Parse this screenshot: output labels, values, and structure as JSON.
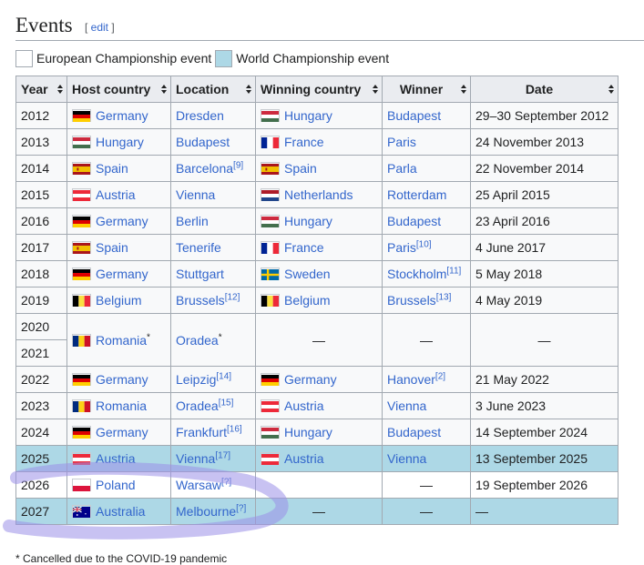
{
  "section": {
    "title": "Events",
    "edit_label": "edit",
    "edit_open": "[ ",
    "edit_close": " ]"
  },
  "legend": [
    {
      "label": "European Championship event",
      "color": "#ffffff"
    },
    {
      "label": "World Championship event",
      "color": "#add8e6"
    }
  ],
  "table": {
    "headers": [
      "Year",
      "Host country",
      "Location",
      "Winning country",
      "Winner",
      "Date"
    ],
    "rows": [
      {
        "year": "2012",
        "host": "Germany",
        "host_flag": "de",
        "location": "Dresden",
        "loc_ref": "",
        "win_country": "Hungary",
        "win_flag": "hu",
        "winner": "Budapest",
        "win_ref": "",
        "date": "29–30 September 2012",
        "type": "european"
      },
      {
        "year": "2013",
        "host": "Hungary",
        "host_flag": "hu",
        "location": "Budapest",
        "loc_ref": "",
        "win_country": "France",
        "win_flag": "fr",
        "winner": "Paris",
        "win_ref": "",
        "date": "24 November 2013",
        "type": "european"
      },
      {
        "year": "2014",
        "host": "Spain",
        "host_flag": "es",
        "location": "Barcelona",
        "loc_ref": "[9]",
        "win_country": "Spain",
        "win_flag": "es",
        "winner": "Parla",
        "win_ref": "",
        "date": "22 November 2014",
        "type": "european"
      },
      {
        "year": "2015",
        "host": "Austria",
        "host_flag": "at",
        "location": "Vienna",
        "loc_ref": "",
        "win_country": "Netherlands",
        "win_flag": "nl",
        "winner": "Rotterdam",
        "win_ref": "",
        "date": "25 April 2015",
        "type": "european"
      },
      {
        "year": "2016",
        "host": "Germany",
        "host_flag": "de",
        "location": "Berlin",
        "loc_ref": "",
        "win_country": "Hungary",
        "win_flag": "hu",
        "winner": "Budapest",
        "win_ref": "",
        "date": "23 April 2016",
        "type": "european"
      },
      {
        "year": "2017",
        "host": "Spain",
        "host_flag": "es",
        "location": "Tenerife",
        "loc_ref": "",
        "win_country": "France",
        "win_flag": "fr",
        "winner": "Paris",
        "win_ref": "[10]",
        "date": "4 June 2017",
        "type": "european"
      },
      {
        "year": "2018",
        "host": "Germany",
        "host_flag": "de",
        "location": "Stuttgart",
        "loc_ref": "",
        "win_country": "Sweden",
        "win_flag": "se",
        "winner": "Stockholm",
        "win_ref": "[11]",
        "date": "5 May 2018",
        "type": "european"
      },
      {
        "year": "2019",
        "host": "Belgium",
        "host_flag": "be",
        "location": "Brussels",
        "loc_ref": "[12]",
        "win_country": "Belgium",
        "win_flag": "be",
        "winner": "Brussels",
        "win_ref": "[13]",
        "date": "4 May 2019",
        "type": "european"
      }
    ],
    "merged": {
      "years": [
        "2020",
        "2021"
      ],
      "host": "Romania",
      "host_flag": "ro",
      "host_note": "*",
      "location": "Oradea",
      "loc_note": "*",
      "win_country": "—",
      "winner": "—",
      "date": "—"
    },
    "rows2": [
      {
        "year": "2022",
        "host": "Germany",
        "host_flag": "de",
        "location": "Leipzig",
        "loc_ref": "[14]",
        "win_country": "Germany",
        "win_flag": "de",
        "winner": "Hanover",
        "win_ref": "[2]",
        "date": "21 May 2022",
        "type": "european"
      },
      {
        "year": "2023",
        "host": "Romania",
        "host_flag": "ro",
        "location": "Oradea",
        "loc_ref": "[15]",
        "win_country": "Austria",
        "win_flag": "at",
        "winner": "Vienna",
        "win_ref": "",
        "date": "3 June 2023",
        "type": "european"
      },
      {
        "year": "2024",
        "host": "Germany",
        "host_flag": "de",
        "location": "Frankfurt",
        "loc_ref": "[16]",
        "win_country": "Hungary",
        "win_flag": "hu",
        "winner": "Budapest",
        "win_ref": "",
        "date": "14 September 2024",
        "type": "european"
      },
      {
        "year": "2025",
        "host": "Austria",
        "host_flag": "at",
        "location": "Vienna",
        "loc_ref": "[17]",
        "win_country": "Austria",
        "win_flag": "at",
        "winner": "Vienna",
        "win_ref": "",
        "date": "13 September 2025",
        "type": "world"
      },
      {
        "year": "2026",
        "host": "Poland",
        "host_flag": "pl",
        "location": "Warsaw",
        "loc_ref": "[?]",
        "win_country": "",
        "win_flag": "",
        "winner": "—",
        "win_ref": "",
        "date": "19 September 2026",
        "type": "plain"
      },
      {
        "year": "2027",
        "host": "Australia",
        "host_flag": "au",
        "location": "Melbourne",
        "loc_ref": "[?]",
        "win_country": "—",
        "win_flag": "",
        "winner": "—",
        "win_ref": "",
        "date": "—",
        "type": "world"
      }
    ]
  },
  "colors": {
    "link": "#3366cc",
    "header_bg": "#eaecf0",
    "cell_bg": "#f8f9fa",
    "world_bg": "#add8e6",
    "border": "#a2a9b1",
    "highlighter": "#9b8fe8"
  },
  "footnote": "* Cancelled due to the COVID-19 pandemic"
}
